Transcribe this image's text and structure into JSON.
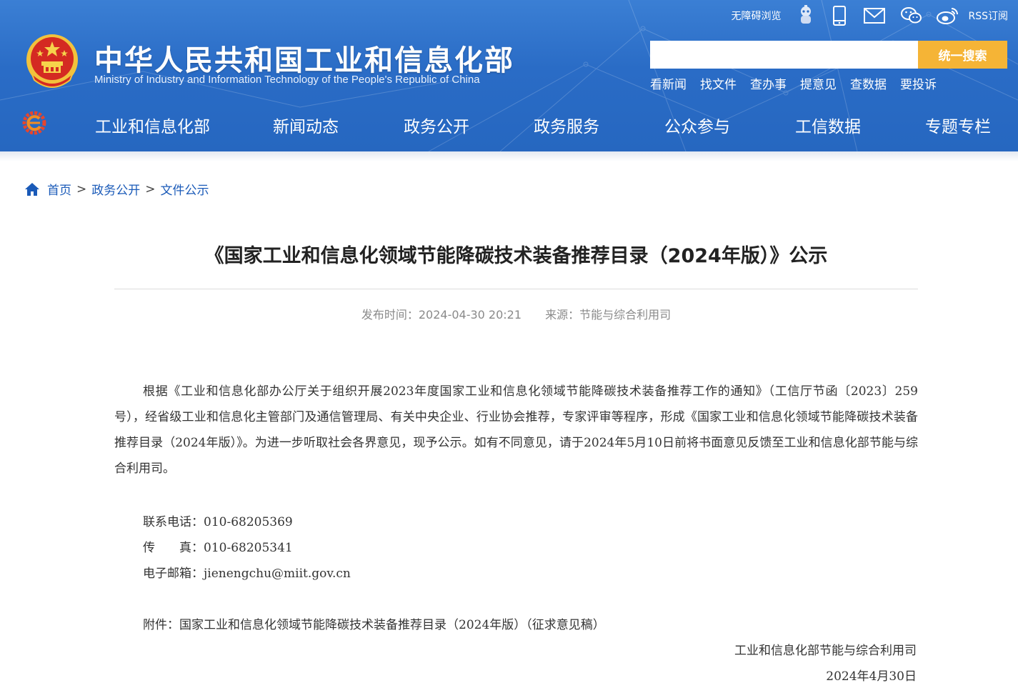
{
  "header": {
    "title": "中华人民共和国工业和信息化部",
    "subtitle": "Ministry of Industry and Information Technology of the People's Republic of China",
    "utility": {
      "accessibility": "无障碍浏览",
      "rss": "RSS订阅",
      "icons": [
        "robot-icon",
        "mobile-icon",
        "mail-icon",
        "wechat-icon",
        "weibo-icon"
      ]
    },
    "search": {
      "placeholder": "",
      "button": "统一搜索"
    },
    "quick_links": [
      "看新闻",
      "找文件",
      "查办事",
      "提意见",
      "查数据",
      "要投诉"
    ],
    "nav": [
      "工业和信息化部",
      "新闻动态",
      "政务公开",
      "政务服务",
      "公众参与",
      "工信数据",
      "专题专栏"
    ],
    "colors": {
      "header_blue": "#2a6cc6",
      "search_button": "#f5b436",
      "link_blue": "#1a5ab8"
    }
  },
  "breadcrumb": [
    "首页",
    "政务公开",
    "文件公示"
  ],
  "article": {
    "title": "《国家工业和信息化领域节能降碳技术装备推荐目录（2024年版）》公示",
    "publish_time": "发布时间：2024-04-30 20:21",
    "source": "来源：节能与综合利用司",
    "body": "根据《工业和信息化部办公厅关于组织开展2023年度国家工业和信息化领域节能降碳技术装备推荐工作的通知》（工信厅节函〔2023〕259号），经省级工业和信息化主管部门及通信管理局、有关中央企业、行业协会推荐，专家评审等程序，形成《国家工业和信息化领域节能降碳技术装备推荐目录（2024年版）》。为进一步听取社会各界意见，现予公示。如有不同意见，请于2024年5月10日前将书面意见反馈至工业和信息化部节能与综合利用司。",
    "phone": "联系电话：010-68205369",
    "fax": "传　　真：010-68205341",
    "email": "电子邮箱：jienengchu@miit.gov.cn",
    "attachment_label": "附件：",
    "attachment_link": "国家工业和信息化领域节能降碳技术装备推荐目录（2024年版）（征求意见稿）",
    "signature": "工业和信息化部节能与综合利用司",
    "date": "2024年4月30日"
  }
}
